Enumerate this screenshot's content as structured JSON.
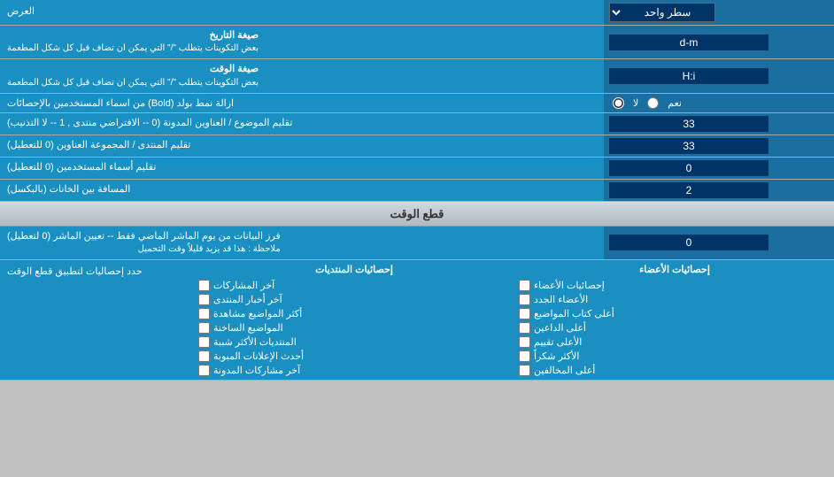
{
  "header": {
    "display_label": "العرض",
    "dropdown_label": "سطر واحد"
  },
  "rows": [
    {
      "id": "date-format",
      "label": "صيغة التاريخ",
      "sublabel": "بعض التكوينات يتطلب \"/\" التي يمكن ان تضاف قبل كل شكل المطعمة",
      "value": "d-m"
    },
    {
      "id": "time-format",
      "label": "صيغة الوقت",
      "sublabel": "بعض التكوينات يتطلب \"/\" التي يمكن ان تضاف قبل كل شكل المطعمة",
      "value": "H:i"
    }
  ],
  "bold_row": {
    "label": "ازالة نمط بولد (Bold) من اسماء المستخدمين بالإحصائات",
    "option_yes": "نعم",
    "option_no": "لا",
    "selected": "no"
  },
  "forum_topic_row": {
    "label": "تقليم الموضوع / العناوين المدونة (0 -- الافتراضي منتدى , 1 -- لا التذنيب)",
    "value": "33"
  },
  "forum_group_row": {
    "label": "تقليم المنتدى / المجموعة العناوين (0 للتعطيل)",
    "value": "33"
  },
  "usernames_row": {
    "label": "تقليم أسماء المستخدمين (0 للتعطيل)",
    "value": "0"
  },
  "spacing_row": {
    "label": "المسافة بين الخانات (بالبكسل)",
    "value": "2"
  },
  "time_cutoff_section": {
    "title": "قطع الوقت"
  },
  "filter_row": {
    "label": "فرز البيانات من يوم الماشر الماضي فقط -- تعيين الماشر (0 لتعطيل)",
    "sublabel": "ملاحظة : هذا قد يزيد قليلاً وقت التحميل",
    "value": "0"
  },
  "stats_section": {
    "main_label": "حدد إحصاليات لتطبيق قطع الوقت",
    "col1_header": "إحصائيات المنتديات",
    "col2_header": "إحصائيات الأعضاء",
    "col1_items": [
      "آخر المشاركات",
      "آخر أخبار المنتدى",
      "أكثر المواضيع مشاهدة",
      "المواضيع الساخنة",
      "المنتديات الأكثر شببة",
      "أحدث الإعلانات المبوبة",
      "آخر مشاركات المدونة"
    ],
    "col2_items": [
      "إحصائيات الأعضاء",
      "الأعضاء الجدد",
      "أعلى كتاب المواضيع",
      "أعلى الداعين",
      "الأعلى تقييم",
      "الأكثر شكراً",
      "أعلى المخالفين"
    ]
  }
}
